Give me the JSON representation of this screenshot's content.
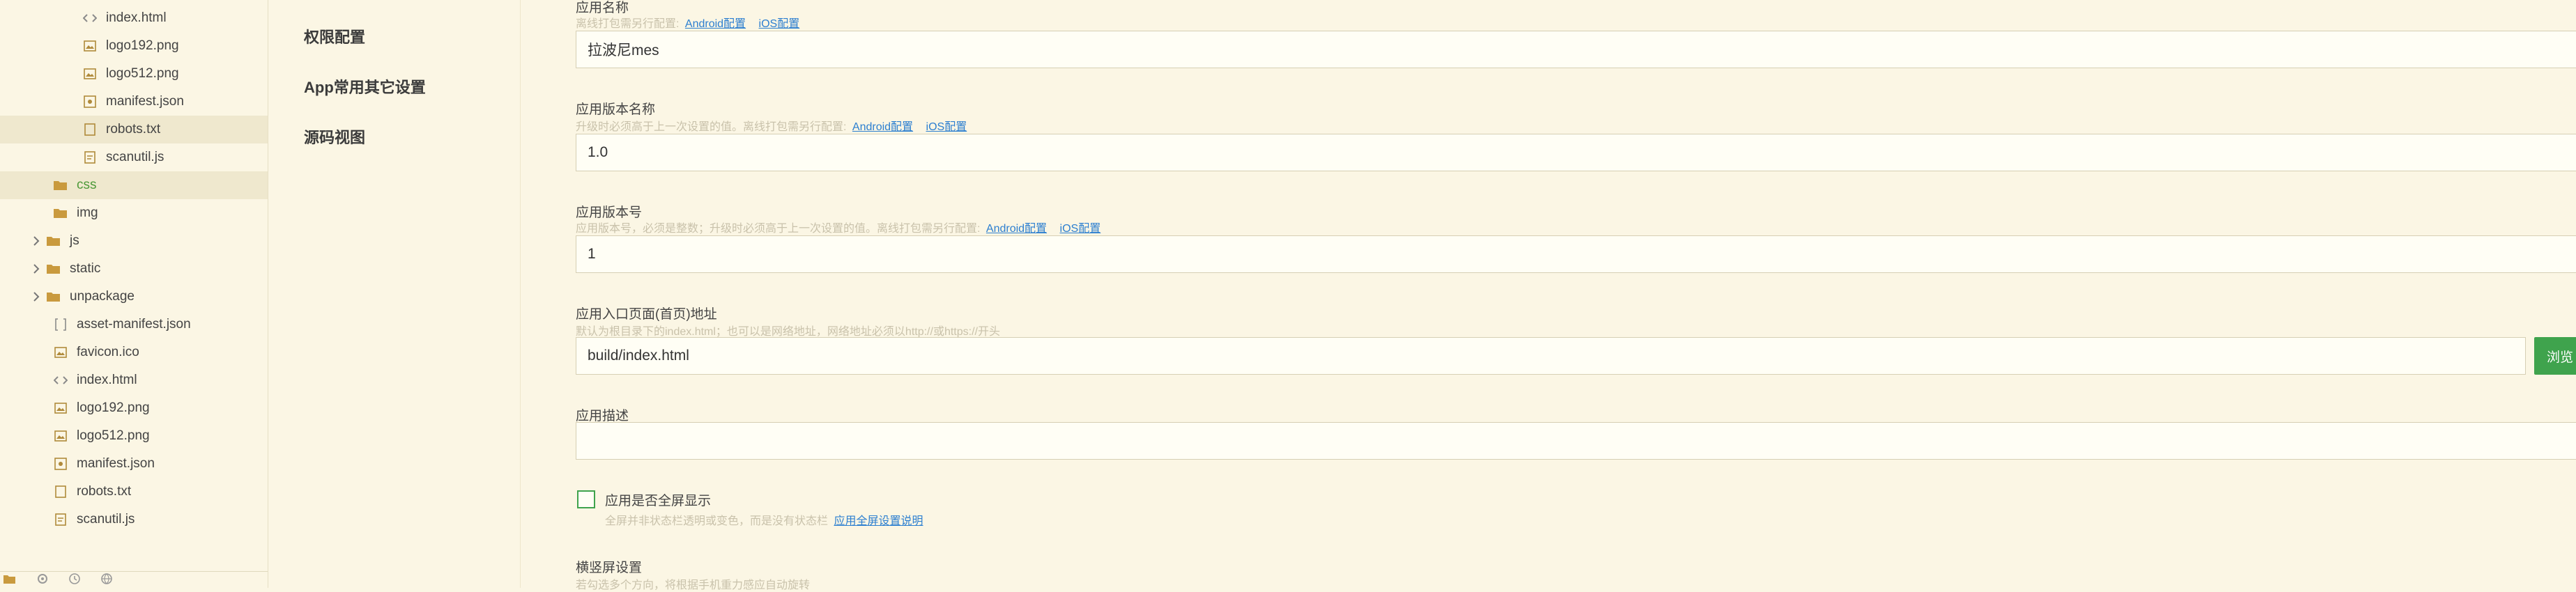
{
  "tree": {
    "items": [
      {
        "label": "index.html",
        "icon": "code-file-icon"
      },
      {
        "label": "logo192.png",
        "icon": "image-file-icon"
      },
      {
        "label": "logo512.png",
        "icon": "image-file-icon"
      },
      {
        "label": "manifest.json",
        "icon": "json-file-icon"
      },
      {
        "label": "robots.txt",
        "icon": "text-file-icon"
      },
      {
        "label": "scanutil.js",
        "icon": "js-file-icon"
      },
      {
        "label": "css",
        "icon": "folder-open-icon"
      },
      {
        "label": "img",
        "icon": "folder-icon"
      },
      {
        "label": "js",
        "icon": "folder-icon"
      },
      {
        "label": "static",
        "icon": "folder-icon"
      },
      {
        "label": "unpackage",
        "icon": "folder-icon"
      },
      {
        "label": "asset-manifest.json",
        "icon": "json-file-icon"
      },
      {
        "label": "favicon.ico",
        "icon": "image-file-icon"
      },
      {
        "label": "index.html",
        "icon": "code-file-icon"
      },
      {
        "label": "logo192.png",
        "icon": "image-file-icon"
      },
      {
        "label": "logo512.png",
        "icon": "image-file-icon"
      },
      {
        "label": "manifest.json",
        "icon": "json-file-icon"
      },
      {
        "label": "robots.txt",
        "icon": "text-file-icon"
      },
      {
        "label": "scanutil.js",
        "icon": "js-file-icon"
      }
    ]
  },
  "nav": {
    "permissions": "权限配置",
    "app_common_other": "App常用其它设置",
    "source_view": "源码视图"
  },
  "form": {
    "app_name": {
      "label": "应用名称",
      "hint": "离线打包需另行配置:",
      "link_android": "Android配置",
      "link_ios": "iOS配置",
      "value": "拉波尼mes"
    },
    "version_name": {
      "label": "应用版本名称",
      "hint": "升级时必须高于上一次设置的值。离线打包需另行配置:",
      "link_android": "Android配置",
      "link_ios": "iOS配置",
      "value": "1.0"
    },
    "version_code": {
      "label": "应用版本号",
      "hint": "应用版本号，必须是整数；升级时必须高于上一次设置的值。离线打包需另行配置:",
      "link_android": "Android配置",
      "link_ios": "iOS配置",
      "value": "1"
    },
    "entry_page": {
      "label": "应用入口页面(首页)地址",
      "hint": "默认为根目录下的index.html；也可以是网络地址，网络地址必须以http://或https://开头",
      "value": "build/index.html",
      "browse_label": "浏览"
    },
    "description": {
      "label": "应用描述",
      "value": ""
    },
    "fullscreen": {
      "label": "应用是否全屏显示",
      "hint": "全屏并非状态栏透明或变色，而是没有状态栏",
      "link": "应用全屏设置说明",
      "checked": false
    },
    "orientation": {
      "label": "横竖屏设置",
      "hint": "若勾选多个方向，将根据手机重力感应自动旋转"
    }
  },
  "colors": {
    "background": "#fbf6e4",
    "accent_green": "#3fa34d",
    "link_blue": "#2c7fd0"
  }
}
